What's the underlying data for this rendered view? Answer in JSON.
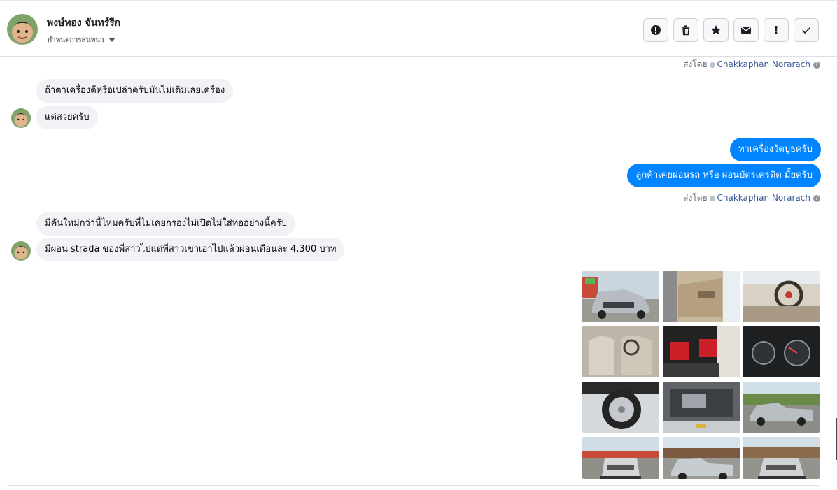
{
  "header": {
    "name": "พงษ์ทอง จันทร์รีก",
    "subtitle": "กำหนดการสนทนา",
    "toolbar": [
      {
        "icon": "alert-circle-icon",
        "label": ""
      },
      {
        "icon": "trash-icon",
        "label": ""
      },
      {
        "icon": "star-icon",
        "label": ""
      },
      {
        "icon": "envelope-icon",
        "label": ""
      },
      {
        "icon": "exclamation-icon",
        "label": "!"
      },
      {
        "icon": "check-icon",
        "label": ""
      }
    ]
  },
  "sent_by": {
    "prefix": "ส่งโดย",
    "name": "Chakkaphan Norarach",
    "help": "?"
  },
  "messages": [
    {
      "side": "in",
      "text": "ถ้าตาเครื่องดีหรือเปล่าครับมันไม่เดิมเลยเครื่อง"
    },
    {
      "side": "in",
      "text": "แต่สวยครับ"
    },
    {
      "side": "out",
      "text": "ทาเครื่องวัดบูธครับ"
    },
    {
      "side": "out",
      "text": "ลูกค้าเคยผ่อนรถ หรือ ผ่อนบัตรเครดิต มั้ยครับ"
    },
    {
      "side": "in",
      "text": "มีคันใหม่กว่านี้ไหมครับที่ไม่เคยกรองไม่เปิดไม่ใส่ท่ออย่างนี้ครับ"
    },
    {
      "side": "in",
      "text": "มีผ่อน strada ของพี่สาวไปแต่พี่สาวเขาเอาไปแล้วผ่อนเดือนละ 4,300 บาท"
    }
  ],
  "photos": [
    {
      "subject": "silver-pickup-front"
    },
    {
      "subject": "door-interior"
    },
    {
      "subject": "steering-wheel"
    },
    {
      "subject": "front-seats"
    },
    {
      "subject": "red-black-seat"
    },
    {
      "subject": "gauge-cluster"
    },
    {
      "subject": "wheel-rim"
    },
    {
      "subject": "engine-bay"
    },
    {
      "subject": "pickup-side"
    },
    {
      "subject": "pickup-rear-lot"
    },
    {
      "subject": "pickup-side-lot"
    },
    {
      "subject": "pickup-rear-right"
    }
  ],
  "colors": {
    "outgoing": "#0084ff",
    "incoming": "#f0f2f5",
    "link": "#385898"
  }
}
